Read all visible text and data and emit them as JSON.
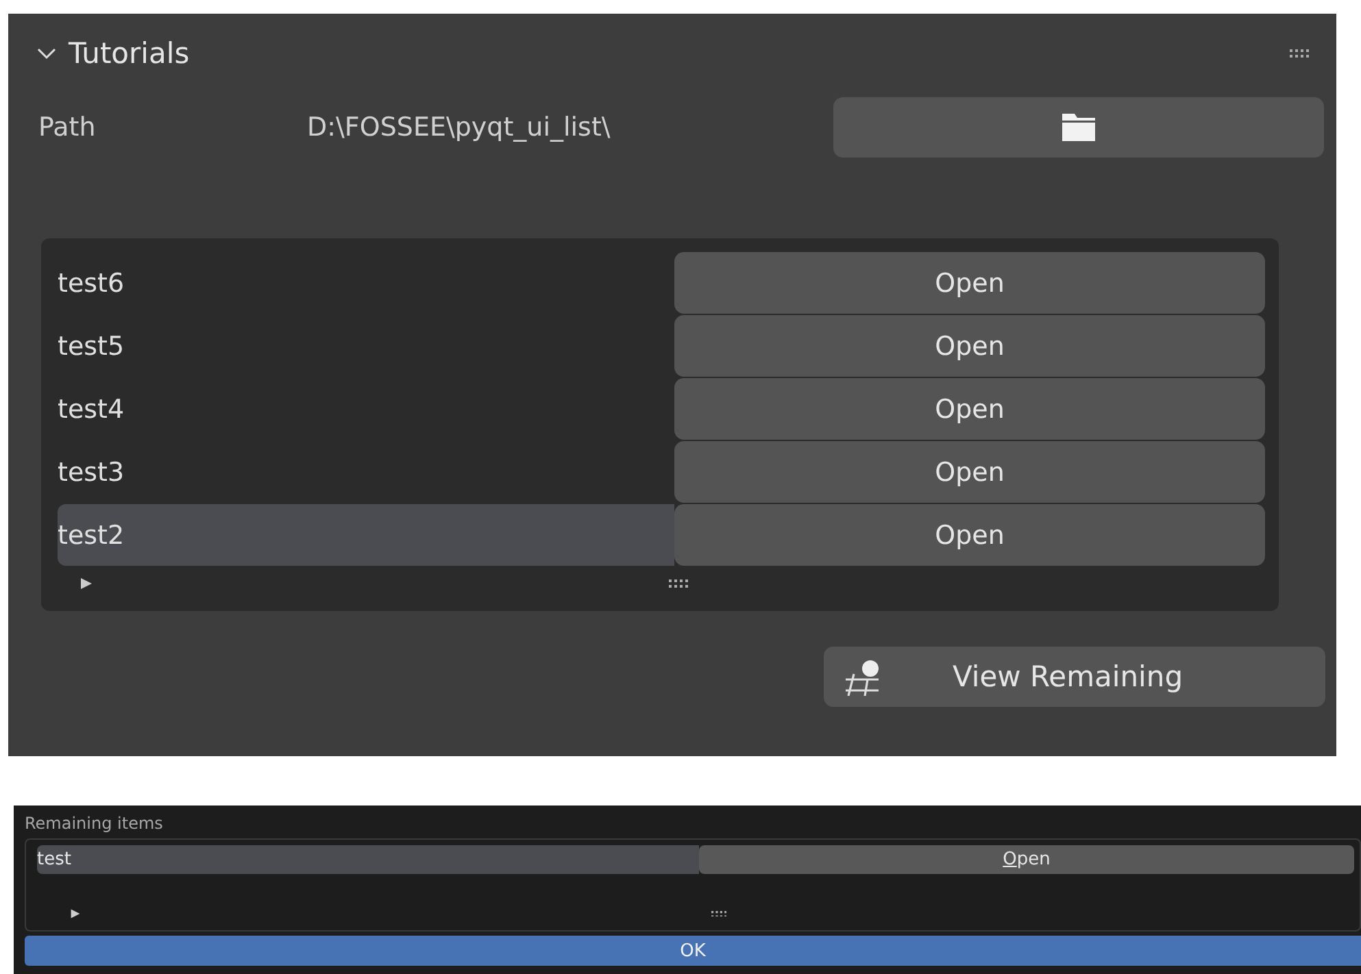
{
  "panel": {
    "title": "Tutorials",
    "expanded": true,
    "path": {
      "label": "Path",
      "value": "D:\\FOSSEE\\pyqt_ui_list\\"
    },
    "items": [
      {
        "name": "test6",
        "action": "Open",
        "selected": false
      },
      {
        "name": "test5",
        "action": "Open",
        "selected": false
      },
      {
        "name": "test4",
        "action": "Open",
        "selected": false
      },
      {
        "name": "test3",
        "action": "Open",
        "selected": false
      },
      {
        "name": "test2",
        "action": "Open",
        "selected": true
      }
    ],
    "view_button": "View Remaining"
  },
  "dialog": {
    "title": "Remaining items",
    "items": [
      {
        "name": "test",
        "action": "Open",
        "selected": true
      }
    ],
    "ok": "OK"
  }
}
